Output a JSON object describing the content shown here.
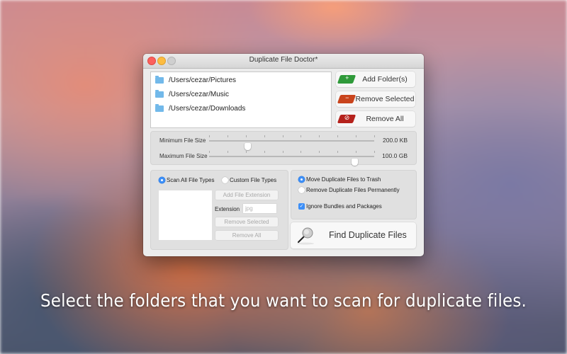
{
  "window": {
    "title": "Duplicate File Doctor*"
  },
  "folders": {
    "items": [
      {
        "path": "/Users/cezar/Pictures",
        "icon": "folder-icon"
      },
      {
        "path": "/Users/cezar/Music",
        "icon": "folder-icon"
      },
      {
        "path": "/Users/cezar/Downloads",
        "icon": "folder-icon"
      }
    ]
  },
  "folder_buttons": {
    "add": {
      "label": "Add Folder(s)",
      "icon": "add-folder-icon",
      "color": "#2f9a3a"
    },
    "remove_selected": {
      "label": "Remove Selected",
      "icon": "remove-folder-icon",
      "color": "#c9441d"
    },
    "remove_all": {
      "label": "Remove All",
      "icon": "remove-all-icon",
      "color": "#b5221c"
    }
  },
  "sizes": {
    "min": {
      "label": "Minimum File Size",
      "value": "200.0 KB",
      "slider_fraction": 0.23
    },
    "max": {
      "label": "Maximum File Size",
      "value": "100.0 GB",
      "slider_fraction": 0.88
    }
  },
  "file_types": {
    "scan_all": {
      "label": "Scan All File Types",
      "selected": true
    },
    "custom": {
      "label": "Custom File Types",
      "selected": false
    },
    "add_extension_label": "Add File Extension",
    "extension_label": "Extension",
    "extension_placeholder": "jpg",
    "remove_selected_label": "Remove Selected",
    "remove_all_label": "Remove All"
  },
  "options": {
    "move_to_trash": {
      "label": "Move Duplicate Files to Trash",
      "selected": true
    },
    "remove_permanently": {
      "label": "Remove Duplicate Files Permanently",
      "selected": false
    },
    "ignore_bundles": {
      "label": "Ignore Bundles and Packages",
      "checked": true
    }
  },
  "find_button": {
    "label": "Find Duplicate Files",
    "icon": "magnifier-icon"
  },
  "caption": "Select the folders that you want to scan for duplicate files."
}
